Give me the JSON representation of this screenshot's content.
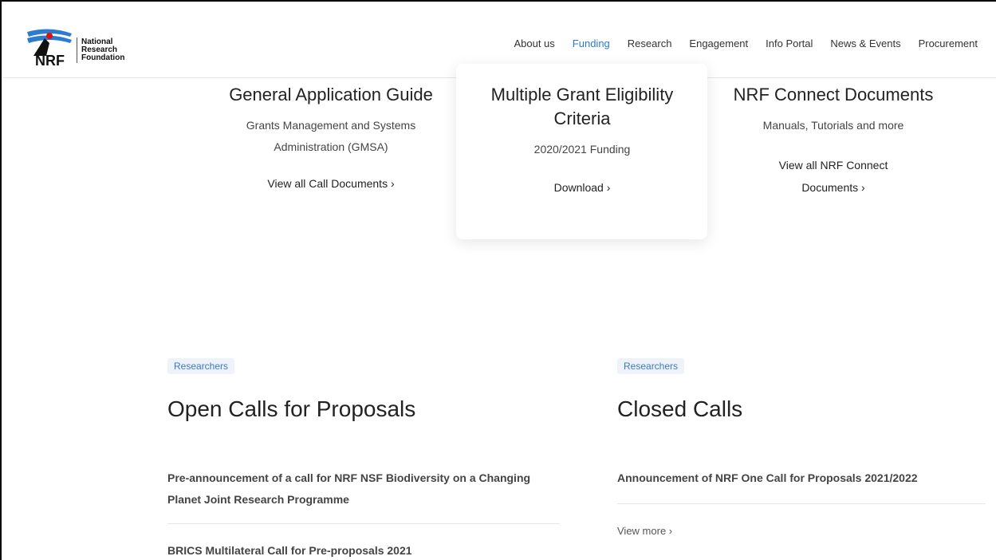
{
  "brand": {
    "logo_text": [
      "National",
      "Research",
      "Foundation"
    ],
    "accent_color": "#2b7bd1"
  },
  "nav": {
    "items": [
      {
        "label": "About us"
      },
      {
        "label": "Funding",
        "active": true
      },
      {
        "label": "Research"
      },
      {
        "label": "Engagement"
      },
      {
        "label": "Info Portal"
      },
      {
        "label": "News & Events"
      },
      {
        "label": "Procurement"
      }
    ]
  },
  "cards": {
    "general": {
      "title": "General Application Guide",
      "desc_line1": "Grants Management and Systems",
      "desc_line2": "Administration (GMSA)",
      "link": "View all Call Documents ›"
    },
    "eligibility": {
      "title_line1": "Multiple Grant Eligibility",
      "title_line2": "Criteria",
      "desc": "2020/2021 Funding",
      "link": "Download ›"
    },
    "connect": {
      "title": "NRF Connect Documents",
      "desc": "Manuals, Tutorials and more",
      "link_line1": "View all NRF Connect",
      "link_line2": "Documents ›"
    }
  },
  "open_calls": {
    "tag": "Researchers",
    "title": "Open Calls for Proposals",
    "items": [
      {
        "line1": "Pre-announcement of a call for NRF NSF Biodiversity on a Changing",
        "line2": "Planet Joint Research Programme"
      },
      {
        "line1": "BRICS Multilateral Call for Pre-proposals 2021"
      }
    ]
  },
  "closed_calls": {
    "tag": "Researchers",
    "title": "Closed Calls",
    "items": [
      {
        "line1": "Announcement of NRF One Call for Proposals 2021/2022"
      }
    ],
    "view_more": "View more ›"
  }
}
